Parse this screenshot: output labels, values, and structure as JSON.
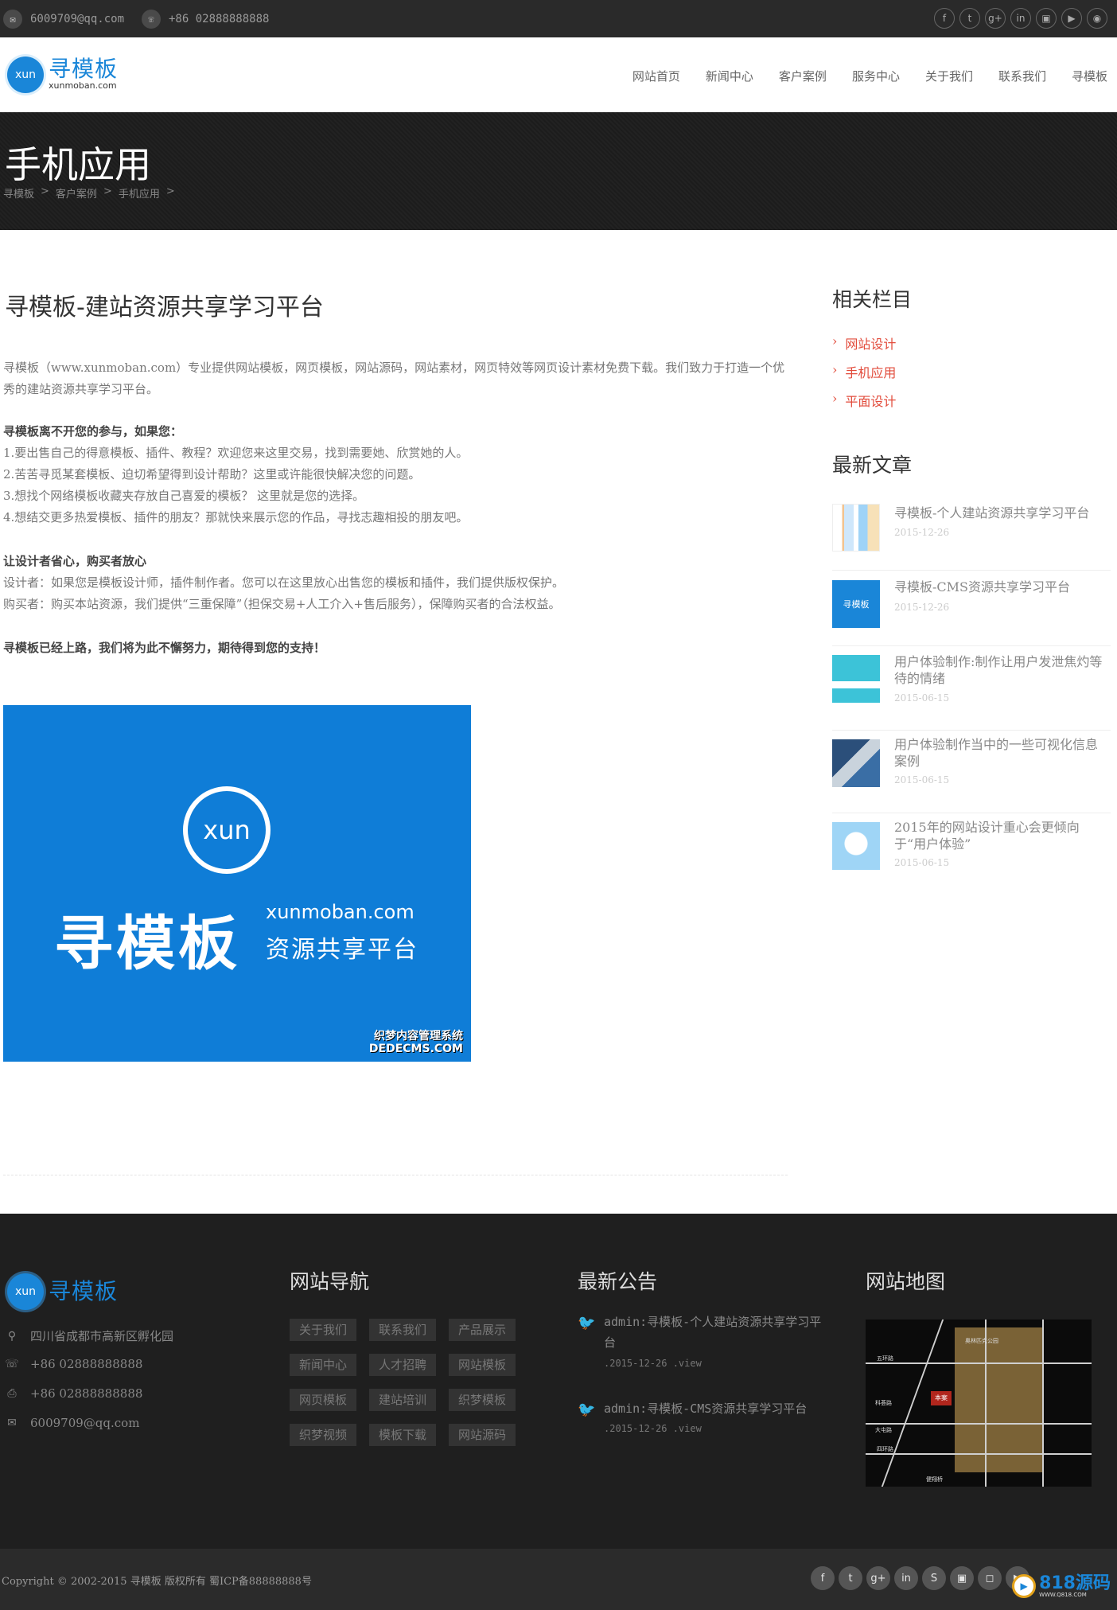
{
  "topbar": {
    "email": "6009709@qq.com",
    "phone": "+86 02888888888",
    "social": [
      "f",
      "t",
      "g+",
      "in",
      "▣",
      "▶",
      "◉"
    ]
  },
  "header": {
    "logo_badge": "xun",
    "logo_cn": "寻模板",
    "logo_en": "xunmoban.com",
    "nav": [
      "网站首页",
      "新闻中心",
      "客户案例",
      "服务中心",
      "关于我们",
      "联系我们",
      "寻模板"
    ]
  },
  "banner": {
    "title": "手机应用",
    "breadcrumb": [
      "寻模板",
      ">",
      "客户案例",
      ">",
      "手机应用",
      ">"
    ]
  },
  "article": {
    "title": "寻模板-建站资源共享学习平台",
    "intro": "寻模板（www.xunmoban.com）专业提供网站模板，网页模板，网站源码，网站素材，网页特效等网页设计素材免费下载。我们致力于打造一个优秀的建站资源共享学习平台。",
    "section1_title": "寻模板离不开您的参与，如果您：",
    "section1_items": [
      "1.要出售自己的得意模板、插件、教程？欢迎您来这里交易，找到需要她、欣赏她的人。",
      "2.苦苦寻觅某套模板、迫切希望得到设计帮助？这里或许能很快解决您的问题。",
      "3.想找个网络模板收藏夹存放自己喜爱的模板？  这里就是您的选择。",
      "4.想结交更多热爱模板、插件的朋友？那就快来展示您的作品，寻找志趣相投的朋友吧。"
    ],
    "section2_title": "让设计者省心，购买者放心",
    "section2_items": [
      "设计者：如果您是模板设计师，插件制作者。您可以在这里放心出售您的模板和插件，我们提供版权保护。",
      "购买者：购买本站资源，我们提供“三重保障”（担保交易+人工介入+售后服务），保障购买者的合法权益。"
    ],
    "closing": "寻模板已经上路，我们将为此不懈努力，期待得到您的支持！",
    "image": {
      "badge": "xun",
      "cn": "寻模板",
      "en": "xunmoban.com",
      "sub": "资源共享平台",
      "mark1": "织梦内容管理系统",
      "mark2": "DEDECMS.COM"
    }
  },
  "sidebar": {
    "related_title": "相关栏目",
    "categories": [
      "网站设计",
      "手机应用",
      "平面设计"
    ],
    "latest_title": "最新文章",
    "posts": [
      {
        "title": "寻模板-个人建站资源共享学习平台",
        "date": "2015-12-26"
      },
      {
        "title": "寻模板-CMS资源共享学习平台",
        "date": "2015-12-26"
      },
      {
        "title": "用户体验制作:制作让用户发泄焦灼等待的情绪",
        "date": "2015-06-15"
      },
      {
        "title": "用户体验制作当中的一些可视化信息案例",
        "date": "2015-06-15"
      },
      {
        "title": "2015年的网站设计重心会更倾向于“用户体验”",
        "date": "2015-06-15"
      }
    ],
    "thumb_badge": "寻模板"
  },
  "footer": {
    "logo_badge": "xun",
    "logo_cn": "寻模板",
    "address": "四川省成都市高新区孵化园",
    "phone": "+86 02888888888",
    "fax": "+86 02888888888",
    "email": "6009709@qq.com",
    "nav_title": "网站导航",
    "nav_tags": [
      "关于我们",
      "联系我们",
      "产品展示",
      "新闻中心",
      "人才招聘",
      "网站模板",
      "网页模板",
      "建站培训",
      "织梦模板",
      "织梦视频",
      "模板下载",
      "网站源码"
    ],
    "notice_title": "最新公告",
    "notices": [
      {
        "text": "admin:寻模板-个人建站资源共享学习平台",
        "meta": ".2015-12-26 .view"
      },
      {
        "text": "admin:寻模板-CMS资源共享学习平台",
        "meta": ".2015-12-26 .view"
      }
    ],
    "map_title": "网站地图",
    "map_labels": {
      "park": "奥林匹克公园",
      "pin": "本案",
      "r1": "五环路",
      "r2": "四环路",
      "r3": "大屯路",
      "r4": "科荟路",
      "r5": "健翔桥"
    }
  },
  "bottom": {
    "copyright": "Copyright © 2002-2015 寻模板 版权所有  蜀ICP备88888888号",
    "social": [
      "f",
      "t",
      "g+",
      "in",
      "S",
      "▣",
      "◻",
      "▶"
    ],
    "wm_main": "818源码",
    "wm_sub": "WWW.Q818.COM"
  },
  "colors": {
    "brand_blue": "#1a86d8",
    "accent_red": "#e24c3c",
    "dark": "#1f1f1f"
  }
}
